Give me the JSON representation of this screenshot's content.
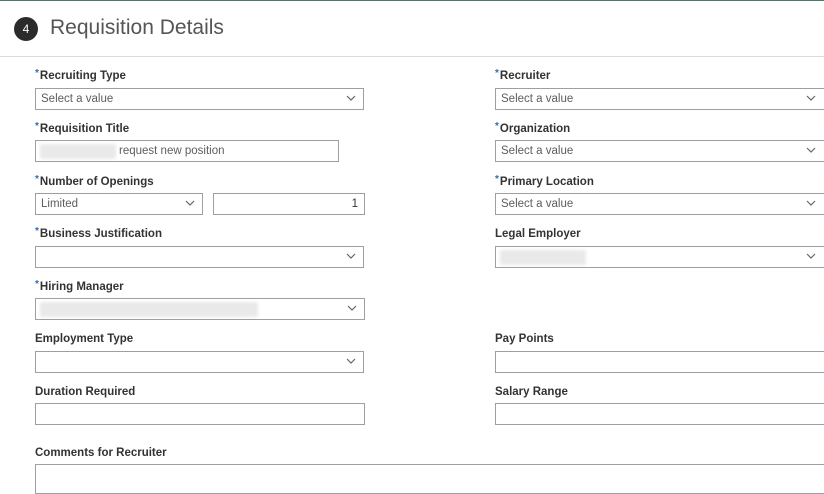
{
  "header": {
    "step_number": "4",
    "title": "Requisition Details"
  },
  "required_marker": "*",
  "fields": {
    "recruiting_type": {
      "label": "Recruiting Type",
      "placeholder": "Select a value"
    },
    "recruiter": {
      "label": "Recruiter",
      "placeholder": "Select a value"
    },
    "requisition_title": {
      "label": "Requisition Title",
      "value": "request new position"
    },
    "organization": {
      "label": "Organization",
      "placeholder": "Select a value"
    },
    "number_of_openings": {
      "label": "Number of Openings",
      "type_value": "Limited",
      "count_value": "1"
    },
    "primary_location": {
      "label": "Primary Location",
      "placeholder": "Select a value"
    },
    "business_justification": {
      "label": "Business Justification",
      "value": ""
    },
    "legal_employer": {
      "label": "Legal Employer",
      "value": ""
    },
    "hiring_manager": {
      "label": "Hiring Manager",
      "value": ""
    },
    "employment_type": {
      "label": "Employment Type",
      "value": ""
    },
    "pay_points": {
      "label": "Pay Points",
      "value": ""
    },
    "duration_required": {
      "label": "Duration Required",
      "value": ""
    },
    "salary_range": {
      "label": "Salary Range",
      "value": ""
    },
    "comments_for_recruiter": {
      "label": "Comments for Recruiter",
      "value": ""
    }
  }
}
